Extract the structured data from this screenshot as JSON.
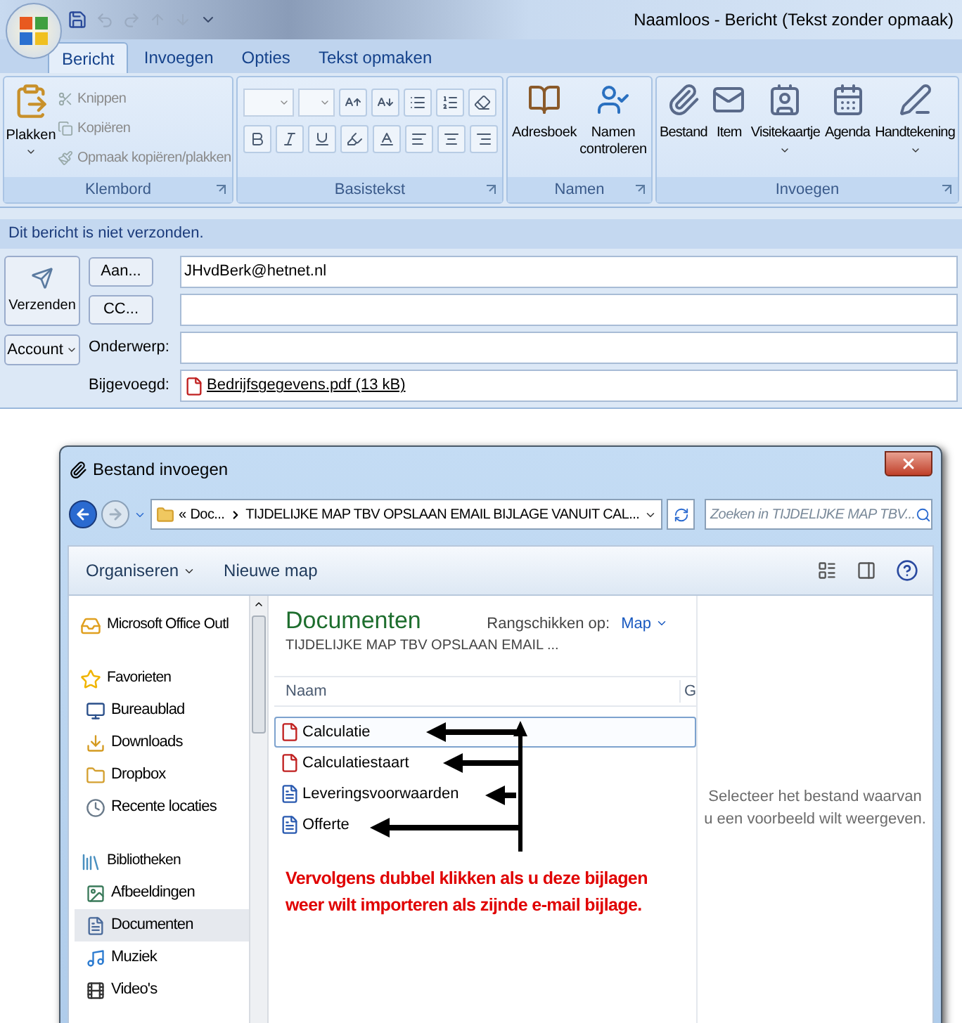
{
  "window": {
    "title": "Naamloos - Bericht (Tekst zonder opmaak)"
  },
  "ribbon_tabs": [
    {
      "label": "Bericht",
      "selected": true
    },
    {
      "label": "Invoegen",
      "selected": false
    },
    {
      "label": "Opties",
      "selected": false
    },
    {
      "label": "Tekst opmaken",
      "selected": false
    }
  ],
  "clipboard": {
    "title": "Klembord",
    "paste": "Plakken",
    "items": [
      {
        "kind": "cut",
        "label": "Knippen",
        "disabled": true
      },
      {
        "kind": "copy",
        "label": "Kopiëren",
        "disabled": true
      },
      {
        "kind": "format",
        "label": "Opmaak kopiëren/plakken",
        "disabled": true
      }
    ]
  },
  "basic_text": {
    "title": "Basistekst"
  },
  "names": {
    "title": "Namen",
    "buttons": [
      {
        "kind": "addressbook",
        "label": "Adresboek"
      },
      {
        "kind": "check",
        "label": "Namen controleren"
      }
    ]
  },
  "insert": {
    "title": "Invoegen",
    "buttons": [
      {
        "kind": "file",
        "label": "Bestand",
        "dropdown": false
      },
      {
        "kind": "item",
        "label": "Item",
        "dropdown": false
      },
      {
        "kind": "card",
        "label": "Visitekaartje",
        "dropdown": true
      },
      {
        "kind": "calendar",
        "label": "Agenda",
        "dropdown": false
      },
      {
        "kind": "signature",
        "label": "Handtekening",
        "dropdown": true
      }
    ]
  },
  "info_bar": "Dit bericht is niet verzonden.",
  "send_button": "Verzenden",
  "account_button": "Account",
  "fields": [
    {
      "kind": "button",
      "label": "Aan...",
      "value": "JHvdBerk@hetnet.nl"
    },
    {
      "kind": "button",
      "label": "CC..."
    },
    {
      "kind": "label",
      "label": "Onderwerp:"
    },
    {
      "kind": "attachment",
      "label": "Bijgevoegd:",
      "value": "Bedrijfsgegevens.pdf (13 kB)"
    }
  ],
  "dialog": {
    "title": "Bestand invoegen",
    "breadcrumb_prefix": "«",
    "breadcrumb": [
      "Doc...",
      "TIJDELIJKE MAP TBV OPSLAAN EMAIL BIJLAGE VANUIT CAL..."
    ],
    "search": {
      "placeholder": "Zoeken in TIJDELIJKE MAP TBV..."
    },
    "toolbar": [
      "Organiseren",
      "Nieuwe map"
    ],
    "nav": [
      {
        "kind": "outlook",
        "label": "Microsoft Office Outl",
        "selected": false
      },
      {
        "kind": "star",
        "label": "Favorieten",
        "selected": false,
        "children": [
          {
            "kind": "desktop",
            "label": "Bureaublad",
            "selected": false
          },
          {
            "kind": "downloads",
            "label": "Downloads",
            "selected": false
          },
          {
            "kind": "folder",
            "label": "Dropbox",
            "selected": false
          },
          {
            "kind": "recent",
            "label": "Recente locaties",
            "selected": false
          }
        ]
      },
      {
        "kind": "library",
        "label": "Bibliotheken",
        "selected": false,
        "children": [
          {
            "kind": "pictures",
            "label": "Afbeeldingen",
            "selected": false
          },
          {
            "kind": "documents",
            "label": "Documenten",
            "selected": true
          },
          {
            "kind": "music",
            "label": "Muziek",
            "selected": false
          },
          {
            "kind": "videos",
            "label": "Video's",
            "selected": false
          }
        ]
      }
    ],
    "library_title": "Documenten",
    "library_subtitle": "TIJDELIJKE MAP TBV OPSLAAN EMAIL ...",
    "arrange_label": "Rangschikken op:",
    "arrange_value": "Map",
    "columns": [
      "Naam",
      "G"
    ],
    "files": [
      {
        "kind": "pdf",
        "name": "Calculatie",
        "selected": true
      },
      {
        "kind": "pdf",
        "name": "Calculatiestaart",
        "selected": false
      },
      {
        "kind": "word",
        "name": "Leveringsvoorwaarden",
        "selected": false
      },
      {
        "kind": "word",
        "name": "Offerte",
        "selected": false
      }
    ],
    "annotation": "Vervolgens dubbel klikken als u deze bijlagen weer wilt importeren als zijnde e-mail bijlage.",
    "preview_text": "Selecteer het bestand waarvan u een voorbeeld wilt weergeven."
  }
}
